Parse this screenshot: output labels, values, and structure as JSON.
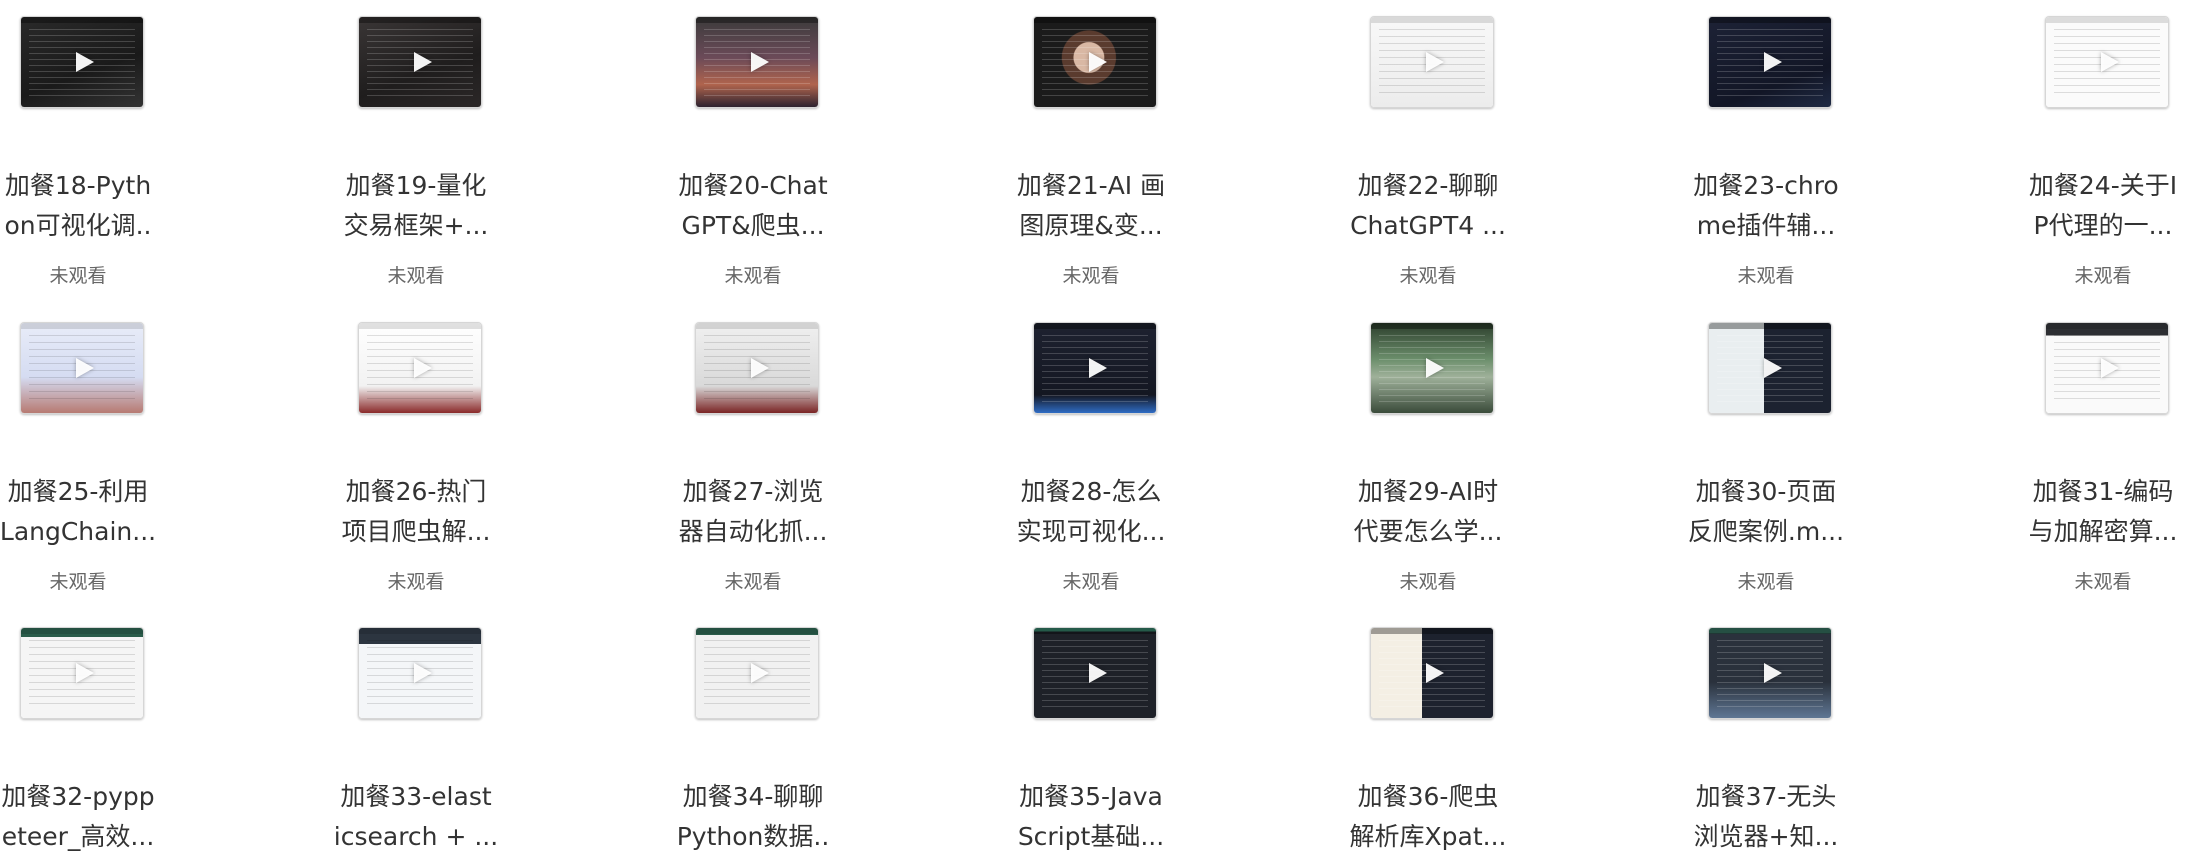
{
  "videos": [
    {
      "title_line1": "加餐18-Pyth",
      "title_line2": "on可视化调..",
      "status": "未观看",
      "thumb": "dark1",
      "light": false
    },
    {
      "title_line1": "加餐19-量化",
      "title_line2": "交易框架+...",
      "status": "未观看",
      "thumb": "dark2",
      "light": false
    },
    {
      "title_line1": "加餐20-Chat",
      "title_line2": "GPT&爬虫...",
      "status": "未观看",
      "thumb": "sunset",
      "light": false
    },
    {
      "title_line1": "加餐21-AI 画",
      "title_line2": "图原理&变...",
      "status": "未观看",
      "thumb": "portrait",
      "light": false
    },
    {
      "title_line1": "加餐22-聊聊",
      "title_line2": "ChatGPT4 ...",
      "status": "未观看",
      "thumb": "doc",
      "light": true
    },
    {
      "title_line1": "加餐23-chro",
      "title_line2": "me插件辅...",
      "status": "未观看",
      "thumb": "navy",
      "light": false
    },
    {
      "title_line1": "加餐24-关于I",
      "title_line2": "P代理的一...",
      "status": "未观看",
      "thumb": "white",
      "light": true
    },
    {
      "title_line1": "加餐25-利用",
      "title_line2": "LangChain...",
      "status": "未观看",
      "thumb": "sky",
      "light": true
    },
    {
      "title_line1": "加餐26-热门",
      "title_line2": "项目爬虫解...",
      "status": "未观看",
      "thumb": "web",
      "light": true
    },
    {
      "title_line1": "加餐27-浏览",
      "title_line2": "器自动化抓...",
      "status": "未观看",
      "thumb": "gray",
      "light": true
    },
    {
      "title_line1": "加餐28-怎么",
      "title_line2": "实现可视化...",
      "status": "未观看",
      "thumb": "editor",
      "light": false
    },
    {
      "title_line1": "加餐29-AI时",
      "title_line2": "代要怎么学...",
      "status": "未观看",
      "thumb": "nature",
      "light": false
    },
    {
      "title_line1": "加餐30-页面",
      "title_line2": "反爬案例.m...",
      "status": "未观看",
      "thumb": "house",
      "light": false
    },
    {
      "title_line1": "加餐31-编码",
      "title_line2": "与加解密算...",
      "status": "未观看",
      "thumb": "docdark",
      "light": true
    },
    {
      "title_line1": "加餐32-pypp",
      "title_line2": "eteer_高效...",
      "status": "",
      "thumb": "grid",
      "light": true
    },
    {
      "title_line1": "加餐33-elast",
      "title_line2": "icsearch + ...",
      "status": "",
      "thumb": "webdark",
      "light": true
    },
    {
      "title_line1": "加餐34-聊聊",
      "title_line2": "Python数据..",
      "status": "",
      "thumb": "flow",
      "light": true
    },
    {
      "title_line1": "加餐35-Java",
      "title_line2": "Script基础...",
      "status": "",
      "thumb": "code",
      "light": false
    },
    {
      "title_line1": "加餐36-爬虫",
      "title_line2": "解析库Xpat...",
      "status": "",
      "thumb": "split",
      "light": false
    },
    {
      "title_line1": "加餐37-无头",
      "title_line2": "浏览器+知...",
      "status": "",
      "thumb": "video",
      "light": false
    }
  ]
}
